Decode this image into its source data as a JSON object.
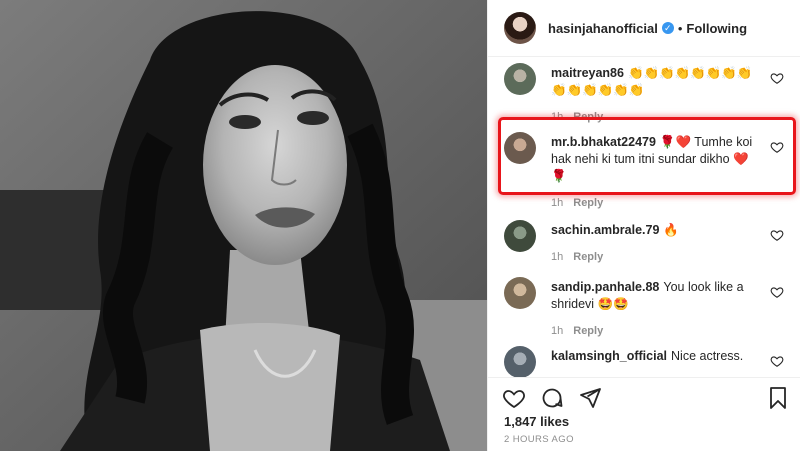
{
  "post": {
    "username": "hasinjahanofficial",
    "verified_mark": "✓",
    "separator": "•",
    "follow_status": "Following"
  },
  "comments": [
    {
      "username": "maitreyan86",
      "text": "👏👏👏👏👏👏👏👏👏👏👏👏👏👏",
      "time": "1h",
      "reply_label": "Reply",
      "avatar_color": "#5c6b5a"
    },
    {
      "username": "mr.b.bhakat22479",
      "text": "🌹❤️ Tumhe koi hak nehi ki tum itni sundar dikho ❤️🌹",
      "time": "1h",
      "reply_label": "Reply",
      "avatar_color": "#6b5a4e",
      "highlighted": true
    },
    {
      "username": "sachin.ambrale.79",
      "text": "🔥",
      "time": "1h",
      "reply_label": "Reply",
      "avatar_color": "#3f4a3c"
    },
    {
      "username": "sandip.panhale.88",
      "text": "You look like a shridevi 🤩🤩",
      "time": "1h",
      "reply_label": "Reply",
      "avatar_color": "#7a6a55"
    },
    {
      "username": "kalamsingh_official",
      "text": "Nice actress.",
      "time": "",
      "reply_label": "",
      "avatar_color": "#55606a"
    }
  ],
  "actions": {
    "likes": "1,847 likes",
    "timestamp": "2 HOURS AGO",
    "icons": [
      "heart-icon",
      "comment-icon",
      "share-icon",
      "bookmark-icon"
    ]
  },
  "colors": {
    "highlight_border": "#e8151b",
    "verified_badge": "#3897f0",
    "meta_text": "#8e8e8e"
  }
}
